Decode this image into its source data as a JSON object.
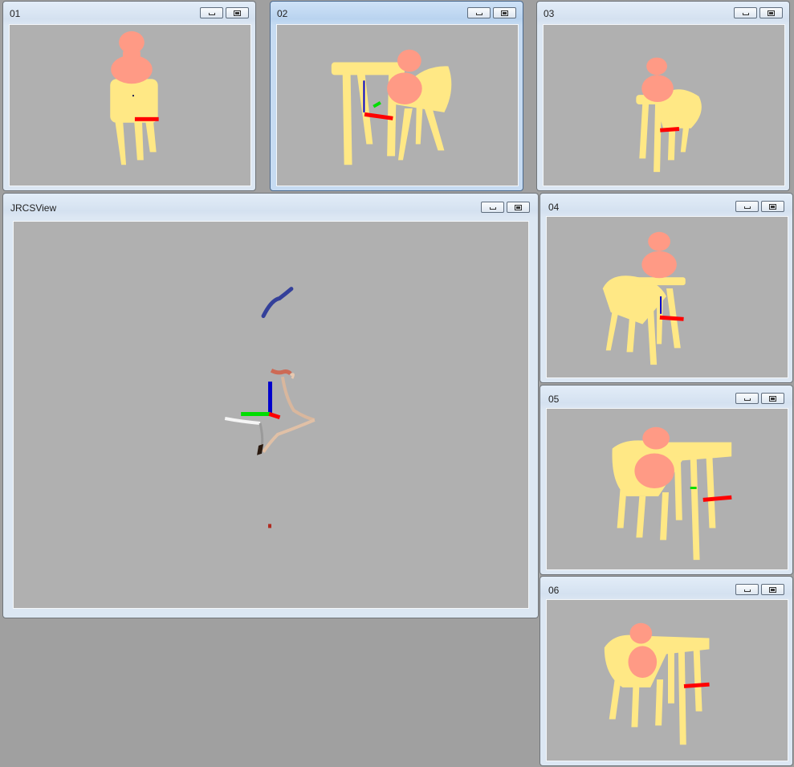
{
  "windows": {
    "w01": {
      "title": "01"
    },
    "w02": {
      "title": "02"
    },
    "w03": {
      "title": "03"
    },
    "w04": {
      "title": "04"
    },
    "w05": {
      "title": "05"
    },
    "w06": {
      "title": "06"
    },
    "main": {
      "title": "JRCSView"
    }
  },
  "icons": {
    "minimize": "minimize-icon",
    "maximize": "maximize-icon"
  },
  "colors": {
    "desktop": "#a0a0a0",
    "viewport": "#b0b0b0",
    "object_yellow": "#ffe885",
    "object_salmon": "#ff9a85",
    "axis_x": "#ff0000",
    "axis_y": "#00dd00",
    "axis_z": "#0000cc",
    "path_blue": "#34409a"
  }
}
